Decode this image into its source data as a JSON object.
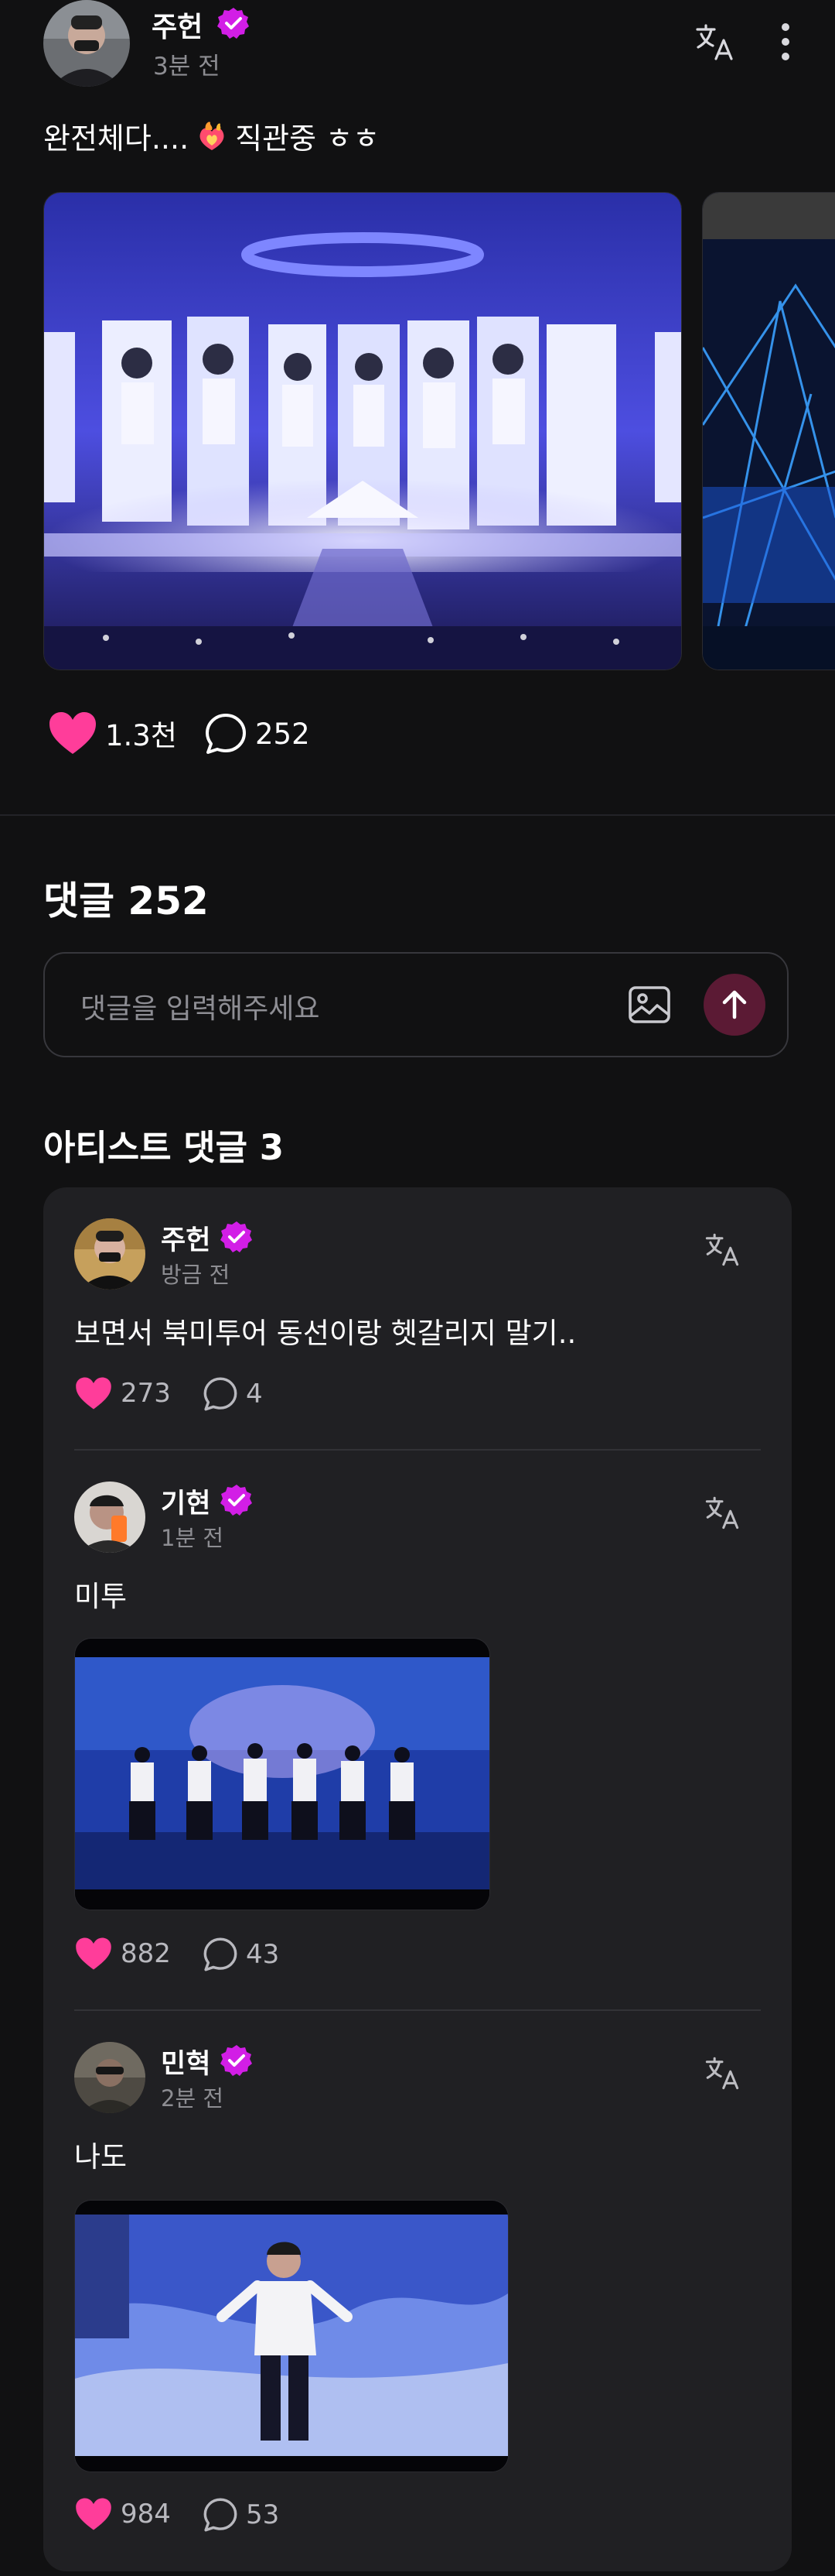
{
  "post": {
    "author": "주헌",
    "time": "3분 전",
    "text_before": "완전체다....",
    "text_after": "직관중 ㅎㅎ",
    "likes": "1.3천",
    "comments": "252"
  },
  "comments_section": {
    "title": "댓글 252",
    "input_placeholder": "댓글을 입력해주세요"
  },
  "artist_comments": {
    "title": "아티스트 댓글 3",
    "items": [
      {
        "author": "주헌",
        "time": "방금 전",
        "text": "보면서 북미투어 동선이랑 헷갈리지 말기..",
        "likes": "273",
        "replies": "4"
      },
      {
        "author": "기현",
        "time": "1분 전",
        "text": "미투",
        "likes": "882",
        "replies": "43"
      },
      {
        "author": "민혁",
        "time": "2분 전",
        "text": "나도",
        "likes": "984",
        "replies": "53"
      }
    ]
  },
  "colors": {
    "background": "#111112",
    "card": "#202023",
    "accent_pink": "#ff3d9a",
    "verified_badge": "#d21ee6"
  },
  "icons": {
    "translate": "translate-icon",
    "more": "more-vertical-icon",
    "heart": "heart-icon",
    "comment": "comment-bubble-icon",
    "image": "image-icon",
    "send": "arrow-up-icon",
    "verified": "verified-badge-icon"
  }
}
